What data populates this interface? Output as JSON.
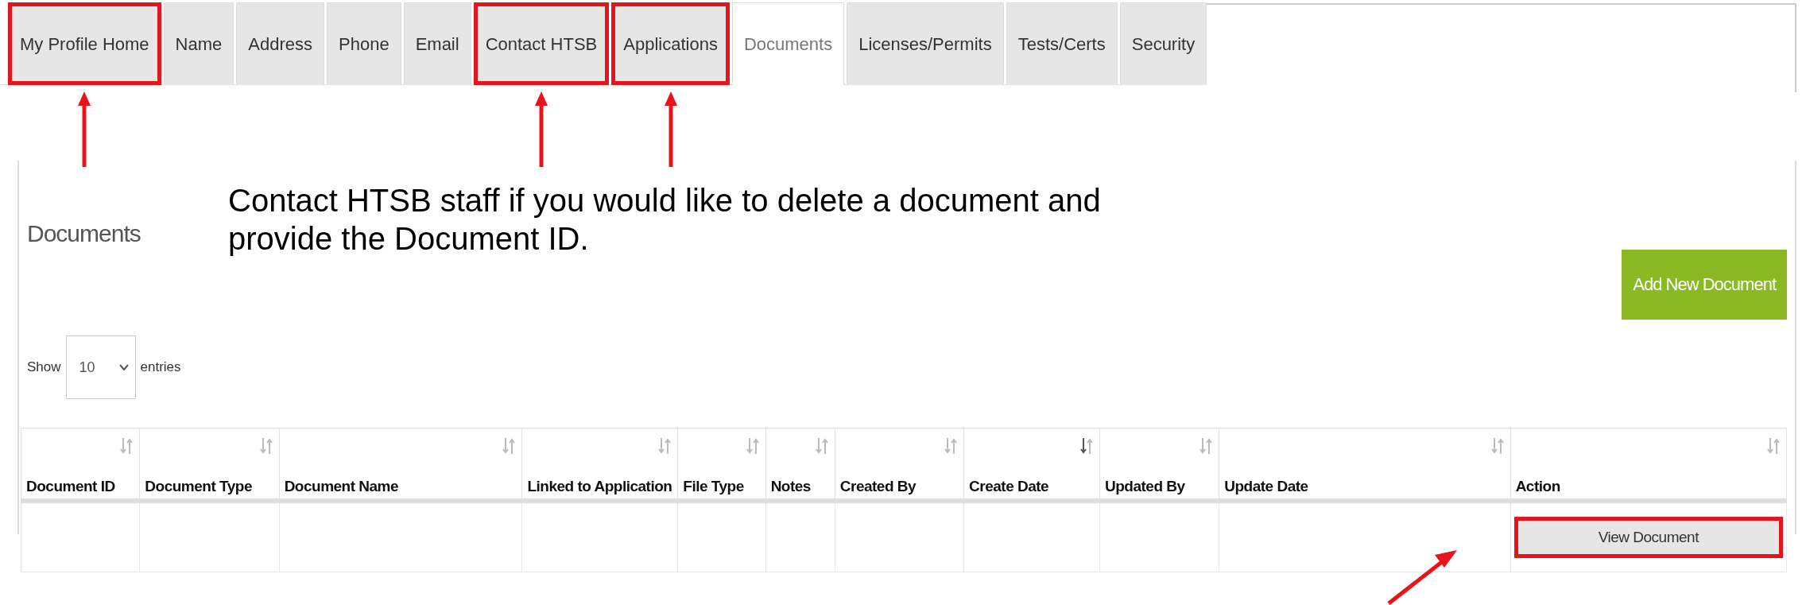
{
  "tabs": [
    {
      "label": "My Profile Home",
      "selected": false,
      "highlighted": true
    },
    {
      "label": "Name",
      "selected": false,
      "highlighted": false
    },
    {
      "label": "Address",
      "selected": false,
      "highlighted": false
    },
    {
      "label": "Phone",
      "selected": false,
      "highlighted": false
    },
    {
      "label": "Email",
      "selected": false,
      "highlighted": false
    },
    {
      "label": "Contact HTSB",
      "selected": false,
      "highlighted": true
    },
    {
      "label": "Applications",
      "selected": false,
      "highlighted": true
    },
    {
      "label": "Documents",
      "selected": true,
      "highlighted": false
    },
    {
      "label": "Licenses/Permits",
      "selected": false,
      "highlighted": false
    },
    {
      "label": "Tests/Certs",
      "selected": false,
      "highlighted": false
    },
    {
      "label": "Security",
      "selected": false,
      "highlighted": false
    }
  ],
  "page_title": "Documents",
  "note": "Contact HTSB staff if you would like to delete a document and provide the Document ID.",
  "add_button": "Add New Document",
  "length_menu": {
    "before": "Show",
    "value": "10",
    "after": "entries"
  },
  "table": {
    "columns": [
      {
        "label": "Document ID",
        "sorted": false
      },
      {
        "label": "Document Type",
        "sorted": false
      },
      {
        "label": "Document Name",
        "sorted": false
      },
      {
        "label": "Linked to Application",
        "sorted": false
      },
      {
        "label": "File Type",
        "sorted": false
      },
      {
        "label": "Notes",
        "sorted": false
      },
      {
        "label": "Created By",
        "sorted": false
      },
      {
        "label": "Create Date",
        "sorted": true
      },
      {
        "label": "Updated By",
        "sorted": false
      },
      {
        "label": "Update Date",
        "sorted": false
      },
      {
        "label": "Action",
        "sorted": false
      }
    ],
    "action_button": {
      "label": "View Document",
      "highlighted": true
    }
  }
}
